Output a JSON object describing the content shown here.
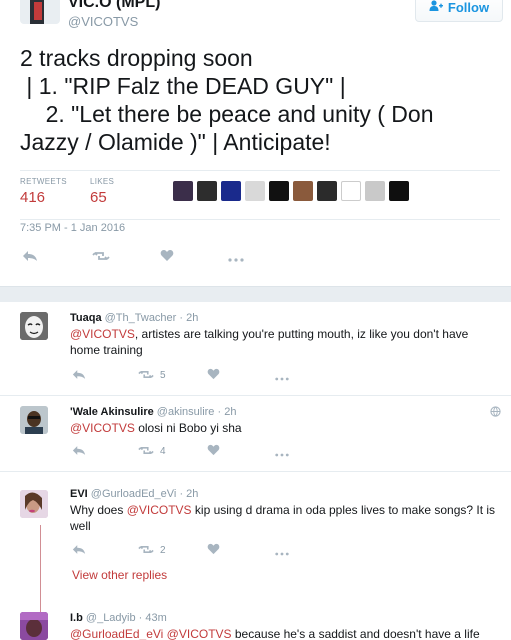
{
  "tweet": {
    "author_name": "VIC.O (MPL)",
    "author_handle": "@VICOTVS",
    "follow_label": "Follow",
    "text_lines": [
      "2 tracks dropping soon",
      " | 1. \"RIP Falz the DEAD GUY\" |",
      "    2. \"Let there be peace and unity ( Don",
      "Jazzy / Olamide )\" | Anticipate!"
    ],
    "retweets_label": "RETWEETS",
    "retweets_count": "416",
    "likes_label": "LIKES",
    "likes_count": "65",
    "timestamp": "7:35 PM - 1 Jan 2016",
    "liker_colors": [
      "#3b2e4a",
      "#2d2d2d",
      "#1a2a8c",
      "#d9d9d9",
      "#111111",
      "#8a5a3c",
      "#2b2b2b",
      "#ffffff",
      "#c9c9c9",
      "#0f0f0f"
    ]
  },
  "replies": [
    {
      "name": "Tuaqa",
      "handle": "@Th_Twacher",
      "time": "· 2h",
      "mention": "@VICOTVS",
      "text": ", artistes are talking you're putting mouth, iz like you don't have home training",
      "retweets": "5",
      "likes": ""
    },
    {
      "name": "'Wale Akinsulire",
      "handle": "@akinsulire",
      "time": "· 2h",
      "mention": "@VICOTVS",
      "text": " olosi ni Bobo yi sha",
      "retweets": "4",
      "likes": ""
    },
    {
      "name": "EVI",
      "handle": "@GurloadEd_eVi",
      "time": "· 2h",
      "pre_text": "Why does ",
      "mention": "@VICOTVS",
      "text": " kip using d drama in oda pples lives to make songs? It is well",
      "retweets": "2",
      "likes": ""
    },
    {
      "name": "I.b",
      "handle": "@_Ladyib",
      "time": "· 43m",
      "mention": "@GurloadEd_eVi @VICOTVS",
      "text": " because he's a saddist and doesn't have a life"
    }
  ],
  "view_other_replies": "View other replies",
  "colors": {
    "accent": "#c23b3b",
    "follow_blue": "#1b95e0",
    "muted": "#8899a6"
  },
  "icons": [
    "reply-icon",
    "retweet-icon",
    "like-icon",
    "more-icon",
    "globe-icon",
    "follow-person-icon"
  ]
}
